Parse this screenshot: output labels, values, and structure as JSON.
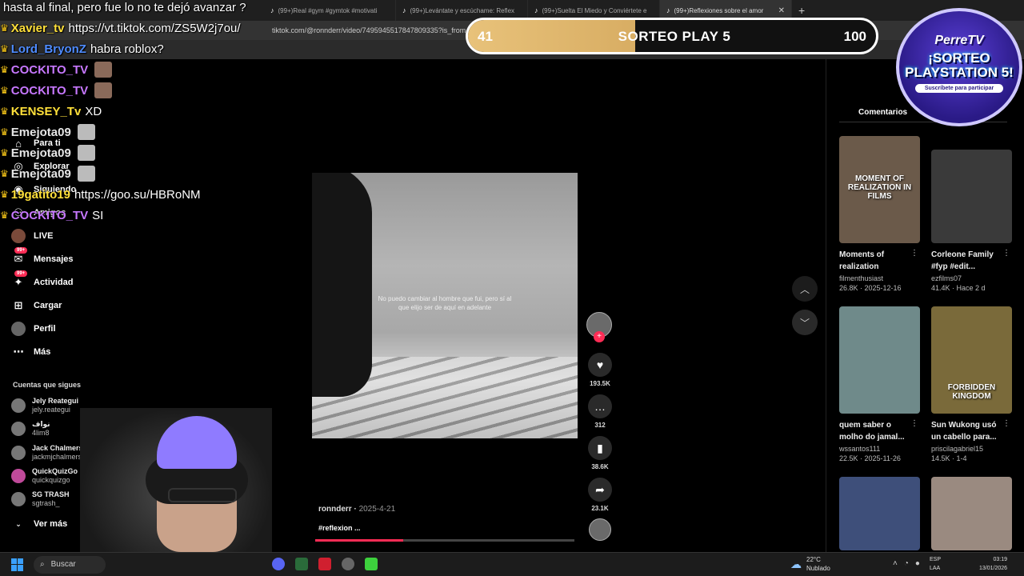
{
  "browser": {
    "tabs": [
      {
        "label": "(99+)Real #gym #gymtok #motivati",
        "active": false
      },
      {
        "label": "(99+)Levántate y escúchame: Reflex",
        "active": false
      },
      {
        "label": "(99+)Suelta El Miedo y Conviértete e",
        "active": false
      },
      {
        "label": "(99+)Reflexiones sobre el amor",
        "active": true
      }
    ],
    "url": "tiktok.com/@ronnderr/video/7495945517847809335?is_from_webapp"
  },
  "chat": {
    "first_line": "hasta al final, pero fue lo no te dejó avanzar ?",
    "messages": [
      {
        "user": "Xavier_tv",
        "color": "#ffe03a",
        "text": "https://vt.tiktok.com/ZS5W2j7ou/"
      },
      {
        "user": "Lord_BryonZ",
        "color": "#4f8cff",
        "text": "habra roblox?"
      },
      {
        "user": "COCKITO_TV",
        "color": "#c778ff",
        "text": ""
      },
      {
        "user": "COCKITO_TV",
        "color": "#c778ff",
        "text": ""
      },
      {
        "user": "KENSEY_Tv",
        "color": "#ffe03a",
        "text": "XD"
      },
      {
        "user": "Emejota09",
        "color": "#e6e6e6",
        "text": ""
      },
      {
        "user": "Emejota09",
        "color": "#e6e6e6",
        "text": ""
      },
      {
        "user": "Emejota09",
        "color": "#e6e6e6",
        "text": ""
      },
      {
        "user": "19gatito19",
        "color": "#ffe03a",
        "text": "https://goo.su/HBRoNM"
      },
      {
        "user": "COCKITO_TV",
        "color": "#c778ff",
        "text": "SI"
      }
    ]
  },
  "sidebar": {
    "nav": [
      {
        "label": "Para ti",
        "icon": "home-icon"
      },
      {
        "label": "Explorar",
        "icon": "compass-icon"
      },
      {
        "label": "Siguiendo",
        "icon": "following-icon"
      },
      {
        "label": "Amigos",
        "icon": "friends-icon"
      },
      {
        "label": "LIVE",
        "icon": "live-icon"
      },
      {
        "label": "Mensajes",
        "icon": "messages-icon",
        "badge": "99+"
      },
      {
        "label": "Actividad",
        "icon": "activity-icon",
        "badge": "99+"
      },
      {
        "label": "Cargar",
        "icon": "upload-icon"
      },
      {
        "label": "Perfil",
        "icon": "profile-icon"
      },
      {
        "label": "Más",
        "icon": "more-icon"
      }
    ],
    "following_title": "Cuentas que sigues",
    "following": [
      {
        "name": "Jely Reategui",
        "handle": "jely.reategui"
      },
      {
        "name": "نواف",
        "handle": "4lim8"
      },
      {
        "name": "Jack Chalmers",
        "handle": "jackmjchalmers"
      },
      {
        "name": "QuickQuizGo",
        "handle": "quickquizgo"
      },
      {
        "name": "SG TRASH",
        "handle": "sgtrash_"
      }
    ],
    "see_more": "Ver más"
  },
  "video": {
    "caption_line1": "No puedo cambiar al hombre que fui, pero sí al",
    "caption_line2": "que elijo ser de aquí en adelante",
    "author": "ronnderr",
    "date": "2025-4-21",
    "hashtag": "#reflexion ...",
    "progress": 0.34,
    "likes": "193.5K",
    "comments": "312",
    "saves": "38.6K",
    "shares": "23.1K"
  },
  "right_panel": {
    "comments_tab": "Comentarios",
    "cards": [
      {
        "overlay": "MOMENT OF REALIZATION IN FILMS",
        "title1": "Moments of",
        "title2": "realization",
        "author": "filmenthusiast",
        "meta": "26.8K · 2025-12-16",
        "color": "#6b5a4a"
      },
      {
        "overlay": "",
        "title1": "Corleone Family",
        "title2": "#fyp #edit...",
        "author": "ezfilms07",
        "meta": "41.4K · Hace 2 d",
        "color": "#3a3a3a"
      },
      {
        "overlay": "",
        "title1": "quem saber o",
        "title2": "molho do jamal...",
        "author": "wssantos111",
        "meta": "22.5K · 2025-11-26",
        "color": "#6f8a8a"
      },
      {
        "overlay": "FORBIDDEN KINGDOM",
        "title1": "Sun Wukong usó",
        "title2": "un cabello para...",
        "author": "priscilagabriel15",
        "meta": "14.5K · 1-4",
        "color": "#7a6a3a"
      },
      {
        "overlay": "",
        "title1": "",
        "title2": "",
        "author": "",
        "meta": "",
        "color": "#3e4f7a"
      },
      {
        "overlay": "",
        "title1": "",
        "title2": "",
        "author": "",
        "meta": "",
        "color": "#9a8a80"
      }
    ]
  },
  "overlay": {
    "raffle_left": "41",
    "raffle_title": "SORTEO PLAY 5",
    "raffle_right": "100",
    "raffle_progress": 0.41,
    "logo_brand": "PerreTV",
    "logo_line1": "¡SORTEO",
    "logo_line2": "PLAYSTATION 5!",
    "logo_cta": "Suscríbete para participar"
  },
  "taskbar": {
    "search": "Buscar",
    "temp": "22°C",
    "weather": "Nublado",
    "lang1": "ESP",
    "lang2": "LAA",
    "time": "03:19",
    "date": "13/01/2026"
  }
}
